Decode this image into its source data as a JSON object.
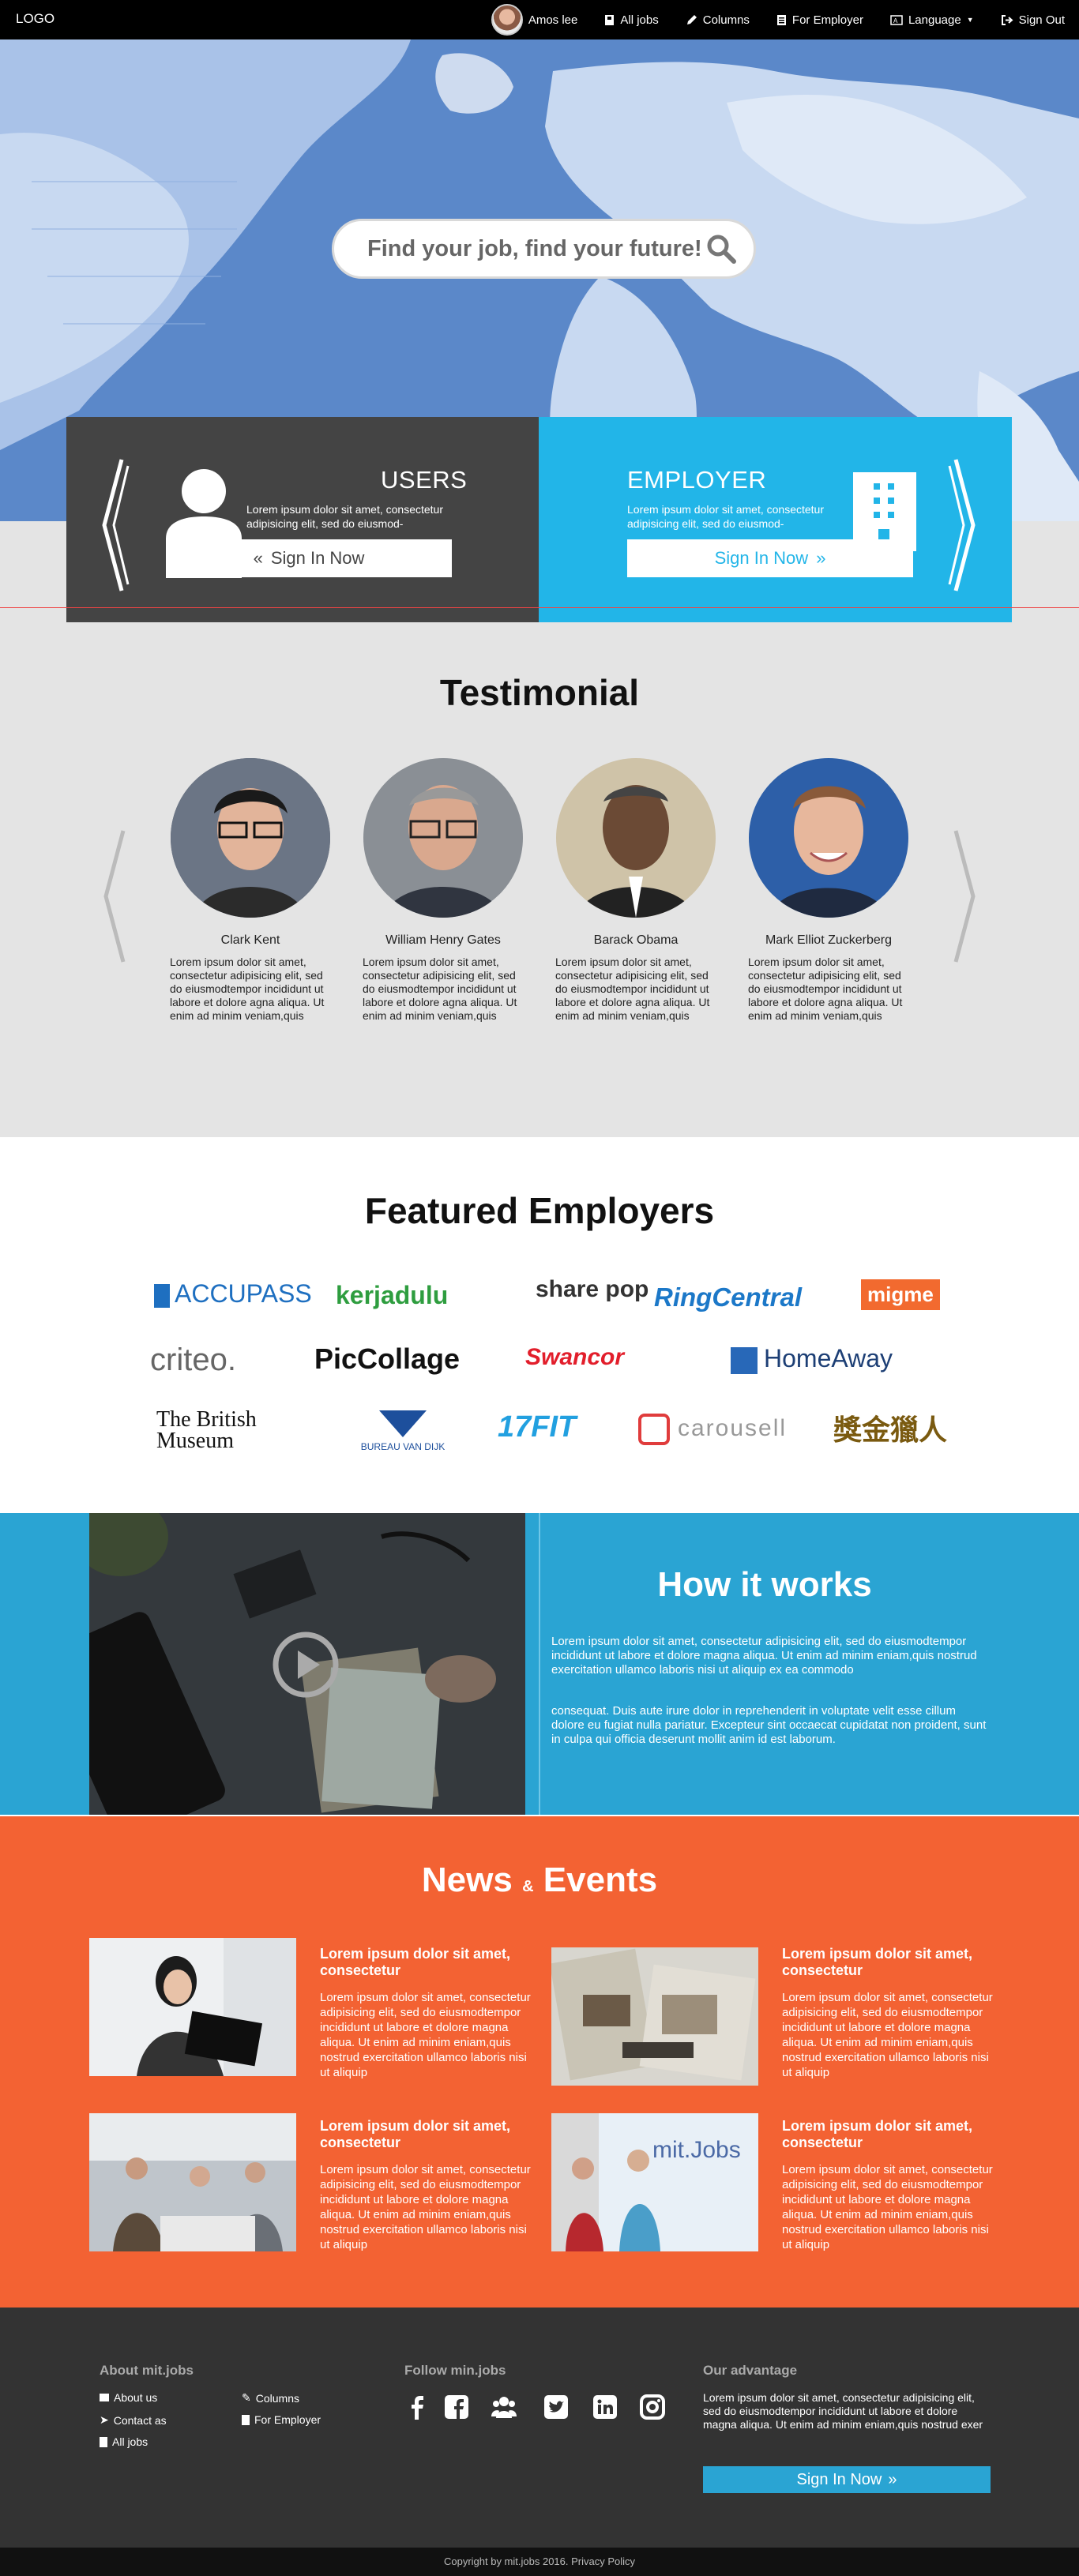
{
  "nav": {
    "logo": "LOGO",
    "user": "Amos lee",
    "links": [
      "All jobs",
      "Columns",
      "For Employer",
      "Language",
      "Sign Out"
    ]
  },
  "hero": {
    "search_placeholder": "Find your job, find your future!"
  },
  "panels": {
    "users": {
      "title": "USERS",
      "text": "Lorem ipsum dolor sit amet, consectetur adipisicing elit, sed do eiusmod-",
      "button": "Sign In Now"
    },
    "employer": {
      "title": "EMPLOYER",
      "text": "Lorem ipsum dolor sit amet, consectetur adipisicing elit, sed do eiusmod-",
      "button": "Sign In Now"
    }
  },
  "testimonial": {
    "title": "Testimonial",
    "people": [
      {
        "name": "Clark Kent",
        "text": "Lorem ipsum dolor sit amet, consectetur adipisicing elit, sed do eiusmodtempor incididunt ut labore et dolore agna aliqua. Ut enim ad minim veniam,quis"
      },
      {
        "name": "William Henry Gates",
        "text": "Lorem ipsum dolor sit amet, consectetur adipisicing elit, sed do eiusmodtempor incididunt ut labore et dolore agna aliqua. Ut enim ad minim veniam,quis"
      },
      {
        "name": "Barack Obama",
        "text": "Lorem ipsum dolor sit amet, consectetur adipisicing elit, sed do eiusmodtempor incididunt ut labore et dolore agna aliqua. Ut enim ad minim veniam,quis"
      },
      {
        "name": "Mark Elliot Zuckerberg",
        "text": "Lorem ipsum dolor sit amet, consectetur adipisicing elit, sed do eiusmodtempor incididunt ut labore et dolore agna aliqua. Ut enim ad minim veniam,quis"
      }
    ]
  },
  "employers": {
    "title": "Featured Employers",
    "logos": [
      "ACCUPASS",
      "kerjadulu",
      "share pop",
      "RingCentral",
      "migme",
      "criteo.",
      "PicCollage",
      "Swancor",
      "HomeAway",
      "The British Museum",
      "BUREAU VAN DIJK",
      "17FIT",
      "carousell",
      "獎金獵人"
    ]
  },
  "how": {
    "title": "How it works",
    "p1": "Lorem ipsum dolor sit amet, consectetur adipisicing elit, sed do eiusmodtempor incididunt ut labore et dolore magna aliqua. Ut enim ad minim eniam,quis nostrud exercitation ullamco laboris nisi ut aliquip ex ea commodo",
    "p2": "consequat. Duis aute irure dolor in reprehenderit in voluptate velit esse cillum dolore eu fugiat nulla pariatur. Excepteur sint occaecat cupidatat non proident, sunt in culpa qui officia deserunt mollit anim id est laborum."
  },
  "news": {
    "title_a": "News",
    "amp": "&",
    "title_b": "Events",
    "items": [
      {
        "title": "Lorem ipsum dolor sit amet, consectetur",
        "text": "Lorem ipsum dolor sit amet, consectetur adipisicing elit, sed do eiusmodtempor incididunt ut labore et dolore magna aliqua. Ut enim ad minim eniam,quis nostrud exercitation ullamco laboris nisi ut aliquip"
      },
      {
        "title": "Lorem ipsum dolor sit amet, consectetur",
        "text": "Lorem ipsum dolor sit amet, consectetur adipisicing elit, sed do eiusmodtempor incididunt ut labore et dolore magna aliqua. Ut enim ad minim eniam,quis nostrud exercitation ullamco laboris nisi ut aliquip"
      },
      {
        "title": "Lorem ipsum dolor sit amet, consectetur",
        "text": "Lorem ipsum dolor sit amet, consectetur adipisicing elit, sed do eiusmodtempor incididunt ut labore et dolore magna aliqua. Ut enim ad minim eniam,quis nostrud exercitation ullamco laboris nisi ut aliquip"
      },
      {
        "title": "Lorem ipsum dolor sit amet, consectetur",
        "text": "Lorem ipsum dolor sit amet, consectetur adipisicing elit, sed do eiusmodtempor incididunt ut labore et dolore magna aliqua. Ut enim ad minim eniam,quis nostrud exercitation ullamco laboris nisi ut aliquip"
      }
    ]
  },
  "footer": {
    "about_title": "About mit.jobs",
    "about_links": [
      "About us",
      "Columns",
      "Contact as",
      "For Employer",
      "All jobs"
    ],
    "follow_title": "Follow min.jobs",
    "advantage_title": "Our advantage",
    "advantage_text": "Lorem ipsum dolor sit amet, consectetur adipisicing elit, sed do eiusmodtempor incididunt ut labore et dolore magna aliqua. Ut enim ad minim eniam,quis nostrud exer",
    "button": "Sign In Now",
    "copyright": "Copyright by mit.jobs 2016. Privacy Policy"
  },
  "colors": {
    "nav": "#000000",
    "employer": "#22b5e8",
    "users": "#444444",
    "how": "#2aa4d3",
    "news": "#f36233",
    "footer": "#333333"
  }
}
